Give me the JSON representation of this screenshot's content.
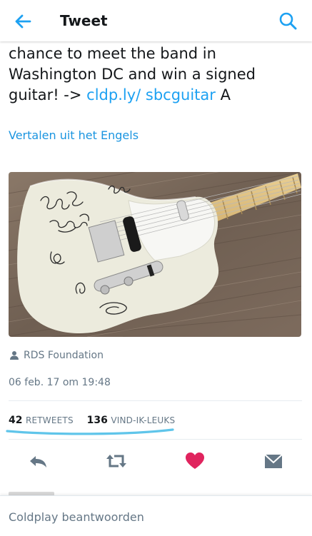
{
  "header": {
    "title": "Tweet",
    "back_icon": "arrow-left-icon",
    "search_icon": "search-icon"
  },
  "tweet": {
    "text_before": "chance to meet the band in Washington DC and win a signed guitar! -> ",
    "link": "cldp.ly/ sbcguitar",
    "text_after": " A",
    "translate": "Vertalen uit het Engels",
    "photo_signatures": [
      "Coldplay",
      "Chris"
    ],
    "attribution": "RDS Foundation",
    "timestamp": "06 feb. 17 om 19:48"
  },
  "stats": {
    "retweets_count": "42",
    "retweets_label": "RETWEETS",
    "likes_count": "136",
    "likes_label": "VIND-IK-LEUKS"
  },
  "actions": [
    "reply-icon",
    "retweet-icon",
    "heart-icon",
    "message-icon"
  ],
  "reply": {
    "placeholder": "Coldplay beantwoorden"
  },
  "colors": {
    "accent": "#1da1f2",
    "like": "#e0245e",
    "icon_gray": "#657786"
  }
}
